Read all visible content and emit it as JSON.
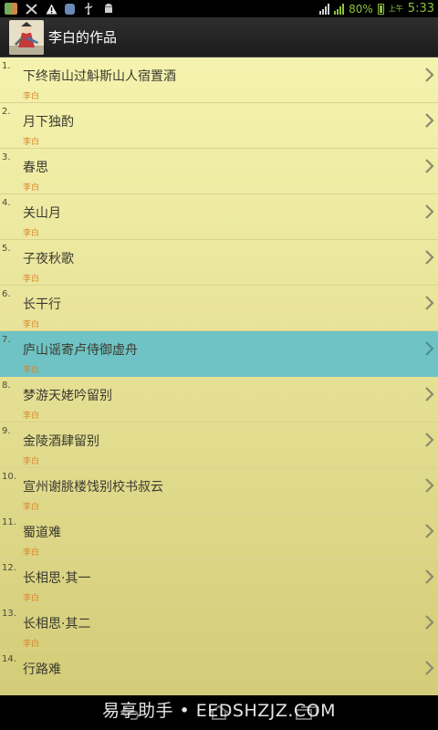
{
  "status_bar": {
    "battery_percent": "80%",
    "ampm": "上午",
    "time": "5:33",
    "left_icons": [
      "app-grid-icon",
      "tools-icon",
      "warning-icon",
      "shield-icon",
      "usb-icon",
      "android-icon"
    ]
  },
  "app_bar": {
    "title": "李白的作品"
  },
  "list": {
    "selected_index": 6,
    "items": [
      {
        "index": "1.",
        "title": "下终南山过斛斯山人宿置酒",
        "author": "李白"
      },
      {
        "index": "2.",
        "title": "月下独酌",
        "author": "李白"
      },
      {
        "index": "3.",
        "title": "春思",
        "author": "李白"
      },
      {
        "index": "4.",
        "title": "关山月",
        "author": "李白"
      },
      {
        "index": "5.",
        "title": "子夜秋歌",
        "author": "李白"
      },
      {
        "index": "6.",
        "title": "长干行",
        "author": "李白"
      },
      {
        "index": "7.",
        "title": "庐山谣寄卢侍御虚舟",
        "author": "李白"
      },
      {
        "index": "8.",
        "title": "梦游天姥吟留别",
        "author": "李白"
      },
      {
        "index": "9.",
        "title": "金陵酒肆留别",
        "author": "李白"
      },
      {
        "index": "10.",
        "title": "宣州谢朓楼饯别校书叔云",
        "author": "李白"
      },
      {
        "index": "11.",
        "title": "蜀道难",
        "author": "李白"
      },
      {
        "index": "12.",
        "title": "长相思·其一",
        "author": "李白"
      },
      {
        "index": "13.",
        "title": "长相思·其二",
        "author": "李白"
      },
      {
        "index": "14.",
        "title": "行路难",
        "author": ""
      }
    ]
  },
  "watermark": "易享助手 • EEDSHZJZ.COM",
  "colors": {
    "selected_row": "#6fc3c4",
    "author_text": "#d9862b",
    "list_bg_top": "#f4f3ae",
    "list_bg_bottom": "#d3cc78",
    "status_green": "#8fc33a"
  }
}
